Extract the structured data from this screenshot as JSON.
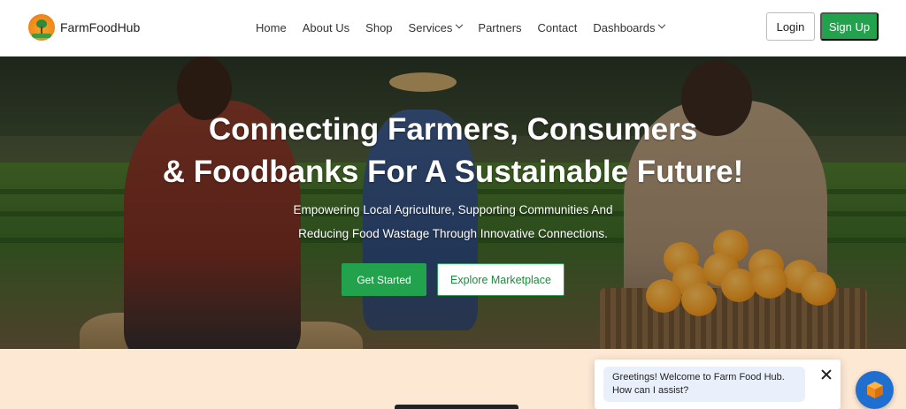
{
  "brand": {
    "name": "FarmFoodHub"
  },
  "nav": {
    "links": [
      {
        "label": "Home"
      },
      {
        "label": "About Us"
      },
      {
        "label": "Shop"
      },
      {
        "label": "Services",
        "dropdown": true
      },
      {
        "label": "Partners"
      },
      {
        "label": "Contact"
      },
      {
        "label": "Dashboards",
        "dropdown": true
      }
    ],
    "login_label": "Login",
    "signup_label": "Sign Up"
  },
  "hero": {
    "title_line1": "Connecting Farmers, Consumers",
    "title_line2": "& Foodbanks For A Sustainable Future!",
    "subtitle_line1": "Empowering Local Agriculture, Supporting Communities And",
    "subtitle_line2": "Reducing Food Wastage Through Innovative Connections.",
    "primary_cta": "Get Started",
    "secondary_cta": "Explore Marketplace"
  },
  "chat": {
    "message_line1": "Greetings! Welcome to Farm Food Hub.",
    "message_line2": "How can I assist?"
  },
  "colors": {
    "accent_green": "#23a24d",
    "below_hero_bg": "#fde8d4",
    "chat_launcher": "#1f6fd1"
  }
}
